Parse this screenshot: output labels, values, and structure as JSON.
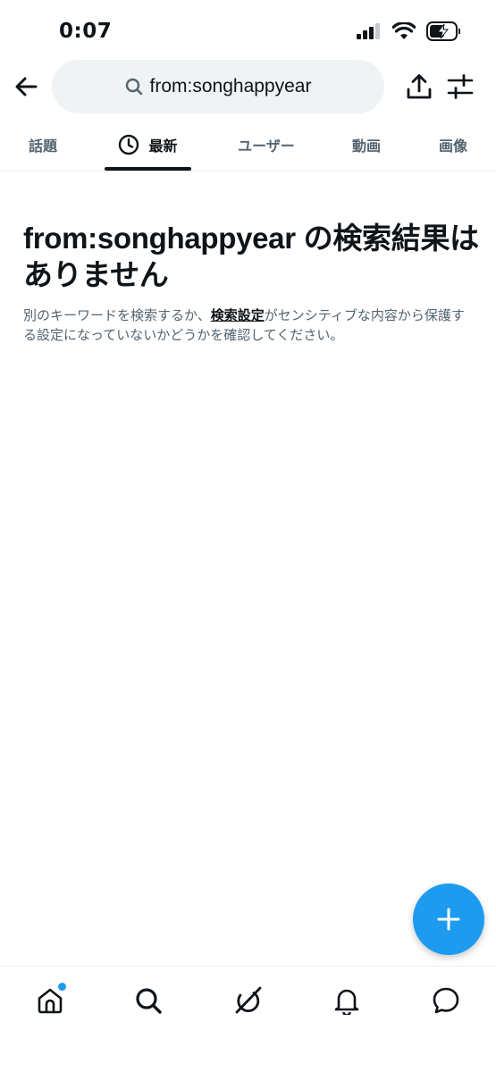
{
  "status_bar": {
    "time": "0:07"
  },
  "search": {
    "query": "from:songhappyear"
  },
  "tabs": [
    {
      "label": "話題",
      "active": false
    },
    {
      "label": "最新",
      "active": true,
      "icon": "clock-icon"
    },
    {
      "label": "ユーザー",
      "active": false
    },
    {
      "label": "動画",
      "active": false
    },
    {
      "label": "画像",
      "active": false
    }
  ],
  "empty_state": {
    "title": "from:songhappyear の検索結果はありません",
    "desc_before": "別のキーワードを検索するか、",
    "desc_link": "検索設定",
    "desc_after": "がセンシティブな内容から保護する設定になっていないかどうかを確認してください。"
  },
  "bottom_nav": {
    "items": [
      "home-icon",
      "search-icon",
      "grok-icon",
      "bell-icon",
      "messages-icon"
    ],
    "home_has_notification": true
  },
  "colors": {
    "accent": "#1d9bf0",
    "text_primary": "#0f1419",
    "text_secondary": "#536471",
    "search_bg": "#eff3f4"
  }
}
